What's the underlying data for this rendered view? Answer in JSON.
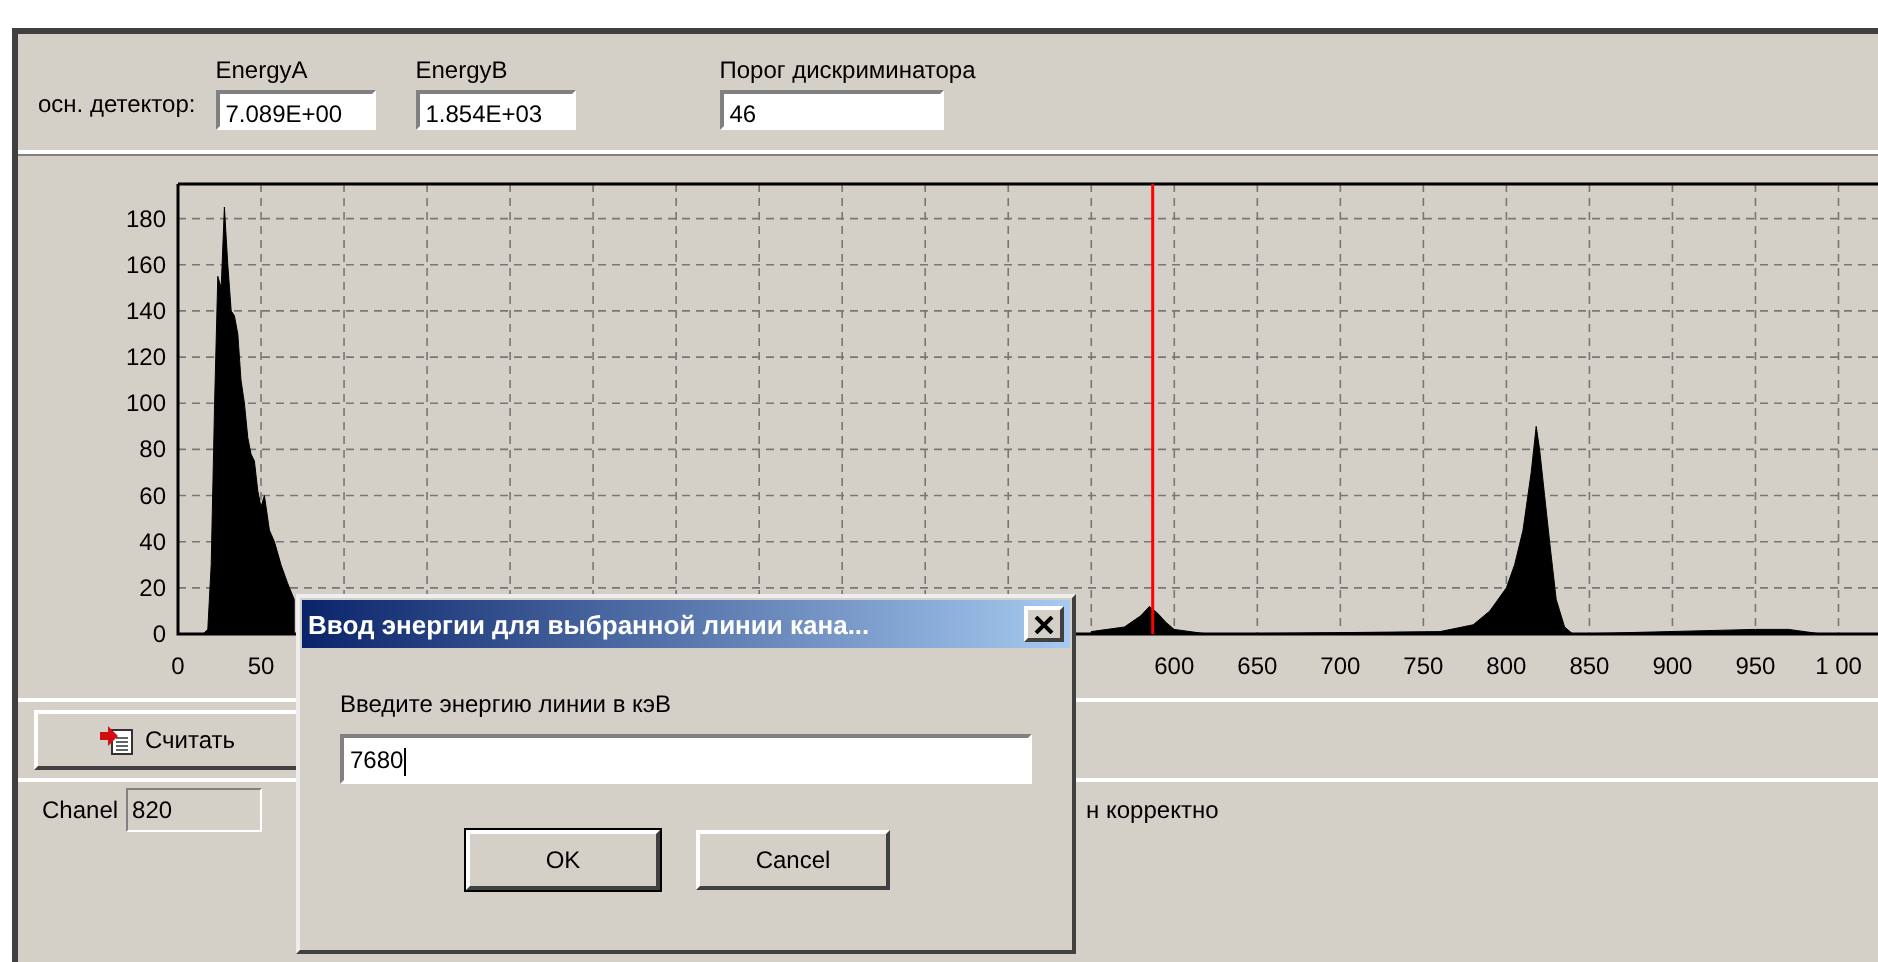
{
  "detector": {
    "label": "осн. детектор:",
    "fields": [
      {
        "label": "EnergyA",
        "value": "7.089E+00"
      },
      {
        "label": "EnergyB",
        "value": "1.854E+03"
      },
      {
        "label": "Порог дискриминатора",
        "value": "46"
      }
    ]
  },
  "spectrum": {
    "chart_data": {
      "type": "area",
      "grid": true,
      "xlim": [
        0,
        1025
      ],
      "ylim": [
        0,
        195
      ],
      "yticks": [
        0,
        20,
        40,
        60,
        80,
        100,
        120,
        140,
        160,
        180
      ],
      "xticks": [
        0,
        50,
        600,
        650,
        700,
        750,
        800,
        850,
        900,
        950,
        {
          "value": 1000,
          "label": "1 00"
        }
      ],
      "x": [
        0,
        15,
        18,
        20,
        22,
        24,
        26,
        28,
        30,
        32,
        34,
        36,
        38,
        40,
        42,
        44,
        46,
        48,
        50,
        52,
        55,
        58,
        62,
        66,
        70,
        75,
        80,
        90,
        100,
        150,
        550,
        570,
        580,
        585,
        590,
        595,
        600,
        620,
        760,
        780,
        790,
        800,
        805,
        810,
        815,
        818,
        820,
        823,
        826,
        830,
        835,
        840,
        950,
        970,
        990,
        1013
      ],
      "series": [
        {
          "color": "#000000",
          "values": [
            0,
            0,
            2,
            30,
            100,
            155,
            150,
            185,
            160,
            140,
            138,
            130,
            110,
            100,
            85,
            78,
            75,
            62,
            55,
            60,
            45,
            40,
            30,
            22,
            15,
            null,
            null,
            null,
            null,
            null,
            1,
            3,
            8,
            12,
            9,
            5,
            2,
            0,
            1,
            4,
            10,
            20,
            30,
            45,
            70,
            90,
            80,
            60,
            40,
            15,
            3,
            0,
            2,
            2,
            0,
            0
          ]
        }
      ],
      "ref_lines": [
        {
          "axis": "x",
          "value": 587,
          "color": "#ff0000"
        }
      ]
    }
  },
  "read_button": "Считать",
  "status": {
    "channel_label": "Chanel",
    "channel_value": "820",
    "message": "н корректно"
  },
  "dialog": {
    "title": "Ввод энергии для выбранной линии кана...",
    "prompt": "Введите энергию линии в кэВ",
    "value": "7680",
    "ok": "OK",
    "cancel": "Cancel"
  }
}
